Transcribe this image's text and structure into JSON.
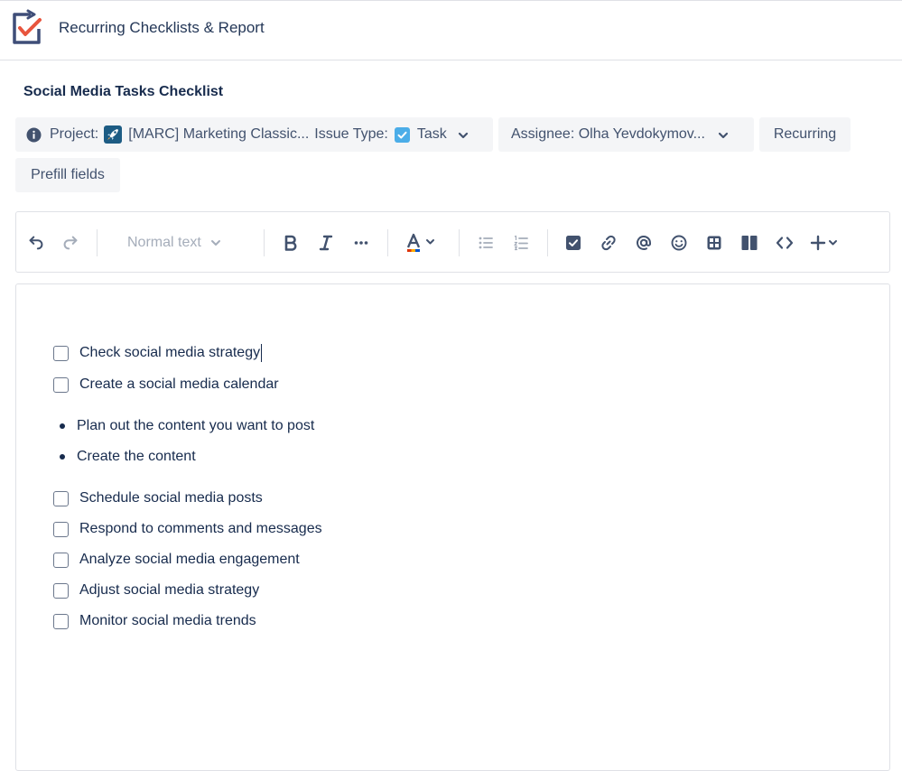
{
  "app": {
    "title": "Recurring Checklists & Report",
    "logo_icon": "checklist-arrow-icon",
    "accent_color": "#e8553e",
    "logo_color": "#3f4e78"
  },
  "checklist": {
    "title": "Social Media Tasks Checklist",
    "fields": {
      "project_label": "Project:",
      "project_value": "[MARC] Marketing Classic...",
      "issue_type_label": "Issue Type:",
      "issue_type_value": "Task",
      "assignee": "Assignee: Olha Yevdokymov...",
      "recurring": "Recurring",
      "prefill": "Prefill fields"
    }
  },
  "toolbar": {
    "text_style": "Normal text",
    "icons": [
      "undo-icon",
      "redo-icon",
      "bold-icon",
      "italic-icon",
      "more-formatting-icon",
      "text-color-icon",
      "bullet-list-icon",
      "numbered-list-icon",
      "action-item-icon",
      "link-icon",
      "mention-icon",
      "emoji-icon",
      "table-icon",
      "layouts-icon",
      "code-icon",
      "insert-icon"
    ]
  },
  "editor": {
    "tasks_group1": [
      {
        "text": "Check social media strategy",
        "checked": false
      },
      {
        "text": "Create a social media calendar",
        "checked": false
      }
    ],
    "bullets": [
      "Plan out the content you want to post",
      "Create the content"
    ],
    "tasks_group2": [
      {
        "text": "Schedule social media posts",
        "checked": false
      },
      {
        "text": "Respond to comments and messages",
        "checked": false
      },
      {
        "text": "Analyze social media engagement",
        "checked": false
      },
      {
        "text": "Adjust social media strategy",
        "checked": false
      },
      {
        "text": "Monitor social media trends",
        "checked": false
      }
    ]
  }
}
